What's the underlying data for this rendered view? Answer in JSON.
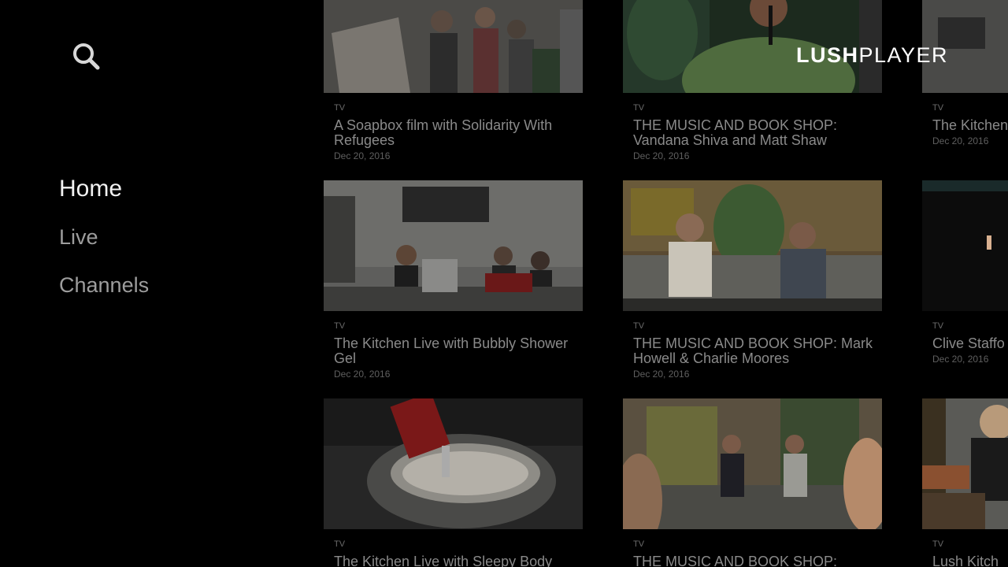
{
  "brand": {
    "part1": "LUSH",
    "part2": "PLAYER"
  },
  "search": {
    "icon": "search-icon"
  },
  "nav": [
    {
      "label": "Home",
      "active": true
    },
    {
      "label": "Live",
      "active": false
    },
    {
      "label": "Channels",
      "active": false
    }
  ],
  "rows": [
    [
      {
        "category": "TV",
        "title": "A Soapbox film with Solidarity With Refugees",
        "date": "Dec 20, 2016"
      },
      {
        "category": "TV",
        "title": "THE MUSIC AND BOOK SHOP: Vandana Shiva and Matt Shaw",
        "date": "Dec 20, 2016"
      },
      {
        "category": "TV",
        "title": "The Kitchen",
        "date": "Dec 20, 2016"
      }
    ],
    [
      {
        "category": "TV",
        "title": "The Kitchen Live with Bubbly Shower Gel",
        "date": "Dec 20, 2016"
      },
      {
        "category": "TV",
        "title": "THE MUSIC AND BOOK SHOP: Mark Howell & Charlie Moores",
        "date": "Dec 20, 2016"
      },
      {
        "category": "TV",
        "title": "Clive Staffo and the dea",
        "date": "Dec 20, 2016"
      }
    ],
    [
      {
        "category": "TV",
        "title": "The Kitchen Live with Sleepy Body",
        "date": ""
      },
      {
        "category": "TV",
        "title": "THE MUSIC AND BOOK SHOP:",
        "date": ""
      },
      {
        "category": "TV",
        "title": "Lush Kitch",
        "date": ""
      }
    ]
  ]
}
